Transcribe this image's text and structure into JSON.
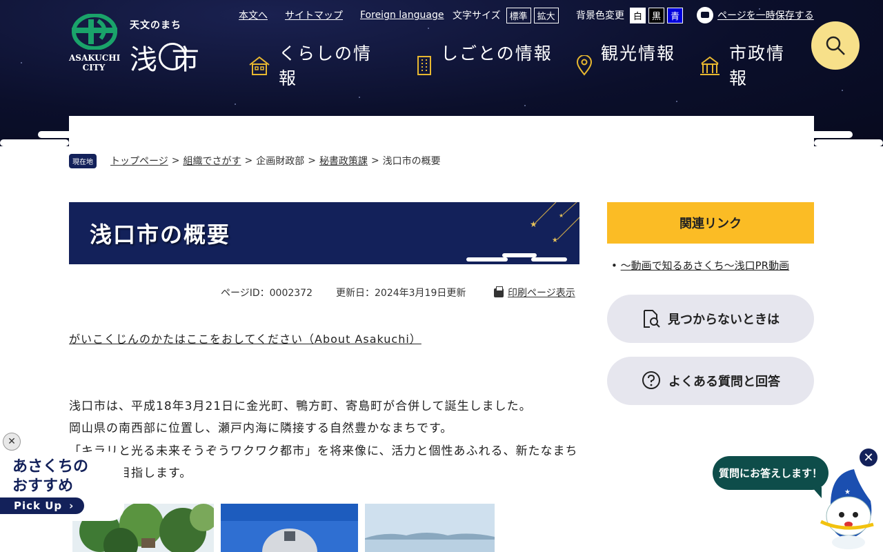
{
  "header": {
    "logo_en": "ASAKUCHI CITY",
    "logo_sub": "天文のまち",
    "logo_city": "浅 市",
    "util_links": [
      "本文へ",
      "サイトマップ",
      "Foreign language"
    ],
    "font_size_label": "文字サイズ",
    "font_size_options": [
      "標準",
      "拡大"
    ],
    "bg_color_label": "背景色変更",
    "bg_color_options": [
      "白",
      "黒",
      "青"
    ],
    "save_link": "ページを一時保存する",
    "nav": [
      {
        "label": "くらしの情報",
        "icon": "house-icon"
      },
      {
        "label": "しごとの情報",
        "icon": "building-icon"
      },
      {
        "label": "観光情報",
        "icon": "map-pin-icon"
      },
      {
        "label": "市政情報",
        "icon": "cityhall-icon"
      }
    ]
  },
  "breadcrumb": {
    "badge": "現在地",
    "items": [
      "トップページ",
      "組織でさがす",
      "企画財政部",
      "秘書政策課",
      "浅口市の概要"
    ],
    "separator": ">"
  },
  "main": {
    "title": "浅口市の概要",
    "page_id": "ページID：0002372",
    "updated": "更新日：2024年3月19日更新",
    "print_link": "印刷ページ表示",
    "about_link": "がいこくじんのかたはここをおしてください（About Asakuchi）",
    "paragraphs": [
      "浅口市は、平成18年3月21日に金光町、鴨方町、寄島町が合併して誕生しました。",
      "岡山県の南西部に位置し、瀬戸内海に隣接する自然豊かなまちです。",
      "「キラリと光る未来そうぞうワクワク都市」を将来像に、活力と個性あふれる、新たなまちづくりを目指します。"
    ]
  },
  "sidebar": {
    "heading": "関連リンク",
    "links": [
      "～動画で知るあさくち～浅口PR動画"
    ],
    "pill_notfound": "見つからないときは",
    "pill_faq": "よくある質問と回答"
  },
  "floating": {
    "pick_close": "✕",
    "pick_title_1": "あさくちの",
    "pick_title_2": "おすすめ",
    "pick_button": "Pick Up",
    "chat_bubble": "質問にお答えします！",
    "chat_close": "✕"
  },
  "colors": {
    "header_bg": "#0b0f2b",
    "navy": "#13215a",
    "accent_yellow": "#fbbc25",
    "search_yellow": "#f7e08a",
    "pill_gray": "#e6e6ee",
    "chat_teal": "#0e4d4a",
    "logo_green": "#1aa36a"
  }
}
